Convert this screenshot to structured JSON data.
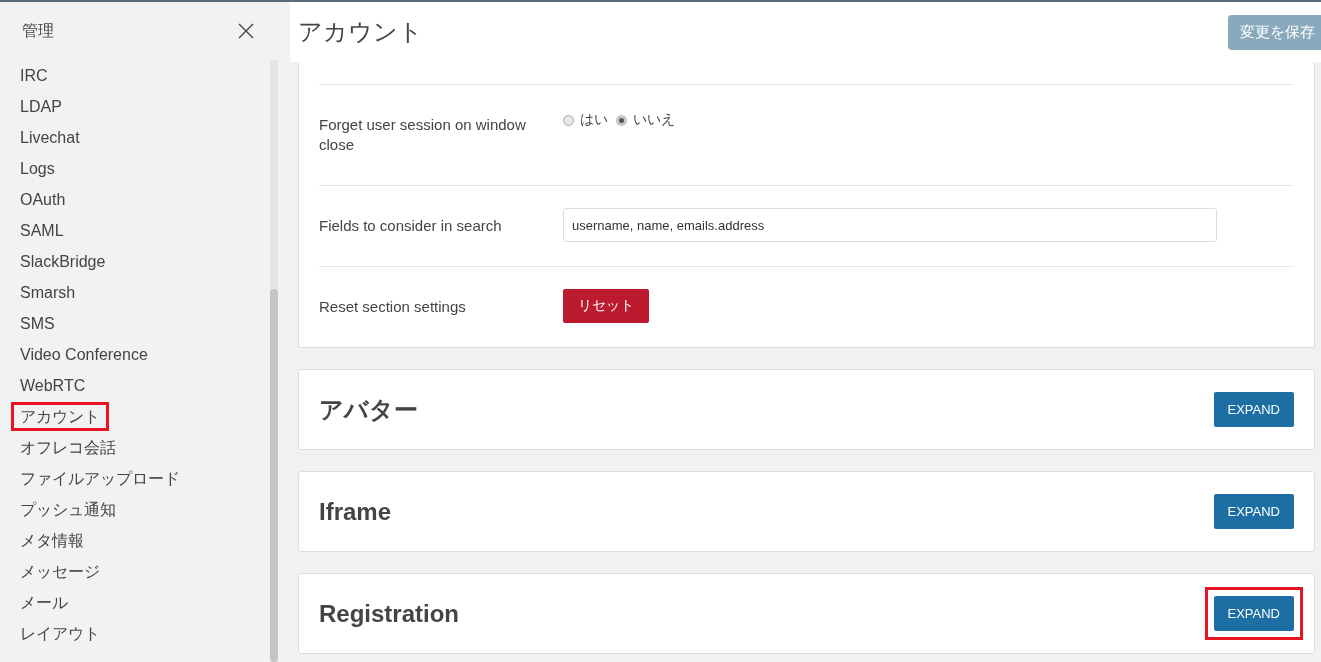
{
  "sidebar": {
    "title": "管理",
    "items": [
      {
        "label": "IRC",
        "selected": false
      },
      {
        "label": "LDAP",
        "selected": false
      },
      {
        "label": "Livechat",
        "selected": false
      },
      {
        "label": "Logs",
        "selected": false
      },
      {
        "label": "OAuth",
        "selected": false
      },
      {
        "label": "SAML",
        "selected": false
      },
      {
        "label": "SlackBridge",
        "selected": false
      },
      {
        "label": "Smarsh",
        "selected": false
      },
      {
        "label": "SMS",
        "selected": false
      },
      {
        "label": "Video Conference",
        "selected": false
      },
      {
        "label": "WebRTC",
        "selected": false
      },
      {
        "label": "アカウント",
        "selected": true
      },
      {
        "label": "オフレコ会話",
        "selected": false
      },
      {
        "label": "ファイルアップロード",
        "selected": false
      },
      {
        "label": "プッシュ通知",
        "selected": false
      },
      {
        "label": "メタ情報",
        "selected": false
      },
      {
        "label": "メッセージ",
        "selected": false
      },
      {
        "label": "メール",
        "selected": false
      },
      {
        "label": "レイアウト",
        "selected": false
      }
    ]
  },
  "header": {
    "title": "アカウント",
    "save_button": "変更を保存"
  },
  "settings": [
    {
      "kind": "radio",
      "label": "Forget user session on window close",
      "options": [
        {
          "label": "はい",
          "selected": false
        },
        {
          "label": "いいえ",
          "selected": true
        }
      ]
    },
    {
      "kind": "text",
      "label": "Fields to consider in search",
      "value": "username, name, emails.address"
    },
    {
      "kind": "reset",
      "label": "Reset section settings",
      "button": "リセット"
    }
  ],
  "sections": [
    {
      "title": "アバター",
      "button": "EXPAND",
      "highlighted": false
    },
    {
      "title": "Iframe",
      "button": "EXPAND",
      "highlighted": false
    },
    {
      "title": "Registration",
      "button": "EXPAND",
      "highlighted": true
    }
  ]
}
